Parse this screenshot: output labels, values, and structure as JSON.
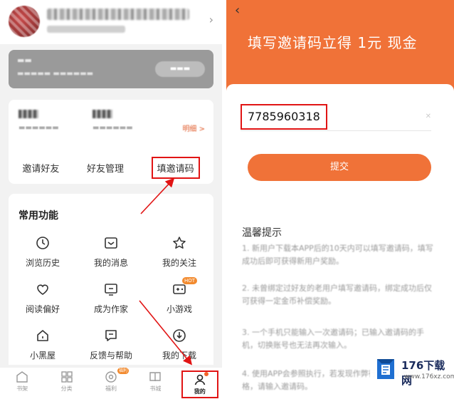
{
  "left": {
    "stats": {
      "detail_link": "明细 >"
    },
    "invite_actions": [
      "邀请好友",
      "好友管理",
      "填邀请码"
    ],
    "functions": {
      "title": "常用功能",
      "items": [
        {
          "label": "浏览历史",
          "icon": "clock-icon"
        },
        {
          "label": "我的消息",
          "icon": "message-icon"
        },
        {
          "label": "我的关注",
          "icon": "star-icon"
        },
        {
          "label": "阅读偏好",
          "icon": "heart-icon"
        },
        {
          "label": "成为作家",
          "icon": "pen-icon"
        },
        {
          "label": "小游戏",
          "icon": "gamepad-icon",
          "badge": "HOT"
        },
        {
          "label": "小黑屋",
          "icon": "house-icon"
        },
        {
          "label": "反馈与帮助",
          "icon": "feedback-icon"
        },
        {
          "label": "我的下载",
          "icon": "download-icon"
        }
      ]
    },
    "tabbar": [
      {
        "label": "书架",
        "icon": "bookshelf-icon"
      },
      {
        "label": "分类",
        "icon": "grid-icon"
      },
      {
        "label": "福利",
        "icon": "gift-icon",
        "badge": "福利"
      },
      {
        "label": "书城",
        "icon": "book-icon"
      },
      {
        "label": "我的",
        "icon": "user-icon",
        "active": true
      }
    ]
  },
  "right": {
    "title": "填写邀请码立得 1元 现金",
    "invite_code": "7785960318",
    "submit_label": "提交",
    "tips_title": "温馨提示",
    "tips": [
      "1. 新用户下载本APP后的10天内可以填写邀请码，填写成功后即可获得新用户奖励。",
      "2. 未曾绑定过好友的老用户填写邀请码，绑定成功后仅可获得一定金币补偿奖励。",
      "3. 一个手机只能输入一次邀请码；已输入邀请码的手机，切换账号也无法再次输入。",
      "4. 使用APP会参照执行，若发现作弊行为将取消奖励资格，请输入邀请码。"
    ]
  },
  "watermark": {
    "name": "176下载网",
    "url": "www.176xz.com"
  },
  "colors": {
    "accent_orange": "#f07238",
    "highlight_red": "#e11414",
    "badge_orange": "#f28a2e"
  }
}
